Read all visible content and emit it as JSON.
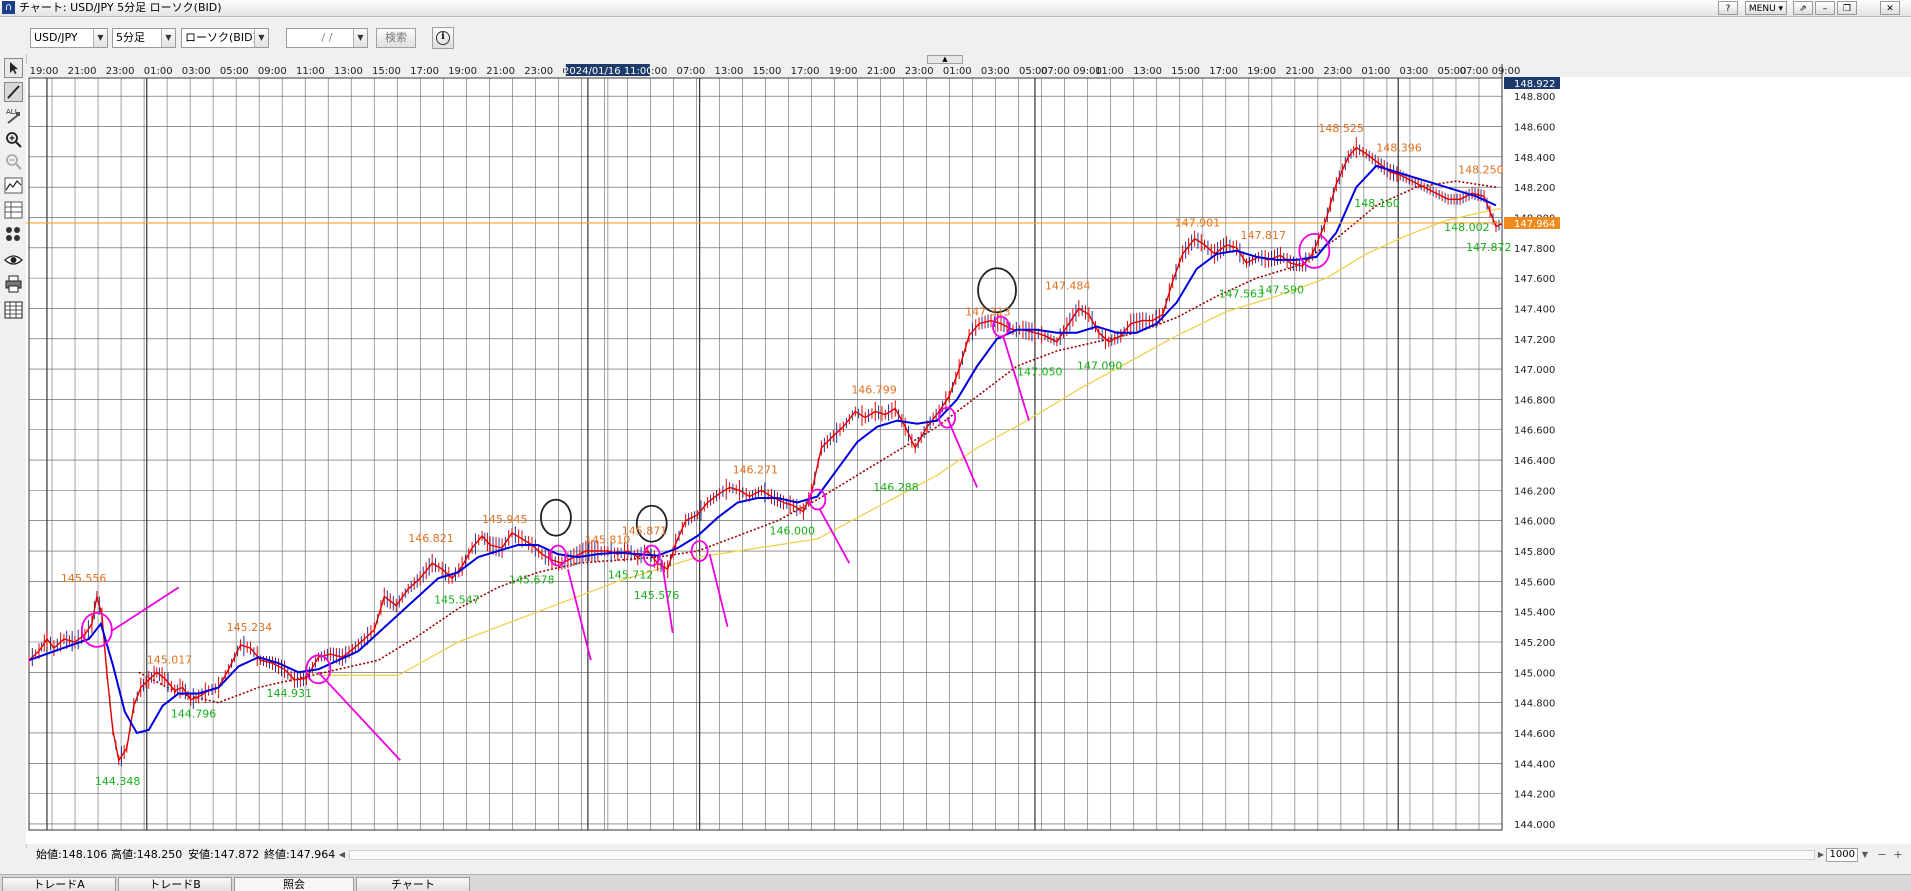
{
  "window": {
    "title": "チャート: USD/JPY 5分足 ローソク(BID)",
    "buttons": [
      "?",
      "MENU ▾",
      "⇗",
      "–",
      "❐",
      "✕"
    ]
  },
  "toolbar": {
    "symbol": "USD/JPY",
    "timeframe": "5分足",
    "price_type": "ローソク(BID)",
    "date_placeholder": "/ /",
    "search_label": "検索"
  },
  "left_tools": [
    "pointer-tool",
    "line-tool",
    "all-delete-tool",
    "zoom-in-tool",
    "zoom-out-tool",
    "indicator-tool",
    "table-tool",
    "pattern-tool",
    "visibility-tool",
    "print-tool",
    "grid-tool"
  ],
  "chart_data": {
    "type": "candlestick-line",
    "symbol": "USD/JPY",
    "y_ticks": [
      "148.800",
      "148.600",
      "148.400",
      "148.200",
      "148.000",
      "147.800",
      "147.600",
      "147.400",
      "147.200",
      "147.000",
      "146.800",
      "146.600",
      "146.400",
      "146.200",
      "146.000",
      "145.800",
      "145.600",
      "145.400",
      "145.200",
      "145.000",
      "144.800",
      "144.600",
      "144.400",
      "144.200",
      "144.000"
    ],
    "ylim": [
      143.96,
      148.92
    ],
    "x_ticks": [
      "19:00",
      "21:00",
      "23:00",
      "01:00",
      "03:00",
      "05:00",
      "09:00",
      "11:00",
      "13:00",
      "15:00",
      "17:00",
      "19:00",
      "21:00",
      "23:00",
      "01:00",
      "03:00",
      "05:00",
      "07:00",
      "13:00",
      "15:00",
      "17:00",
      "19:00",
      "21:00",
      "23:00",
      "01:00",
      "03:00",
      "05:00",
      "07:00 09:00",
      "11:00",
      "13:00",
      "15:00",
      "17:00",
      "19:00",
      "21:00",
      "23:00",
      "01:00",
      "03:00",
      "05:00",
      "07:00 09:00"
    ],
    "cursor_time": "2024/01/16 11:00",
    "cursor_price": "148.922",
    "current_price": "147.964",
    "current_price_level": 147.964,
    "price_path": [
      [
        0,
        145.08
      ],
      [
        10,
        145.14
      ],
      [
        18,
        145.22
      ],
      [
        25,
        145.16
      ],
      [
        35,
        145.22
      ],
      [
        46,
        145.2
      ],
      [
        56,
        145.25
      ],
      [
        63,
        145.32
      ],
      [
        68,
        145.5
      ],
      [
        73,
        145.38
      ],
      [
        78,
        145.0
      ],
      [
        84,
        144.62
      ],
      [
        90,
        144.42
      ],
      [
        98,
        144.5
      ],
      [
        105,
        144.78
      ],
      [
        112,
        144.9
      ],
      [
        120,
        144.95
      ],
      [
        128,
        145.0
      ],
      [
        136,
        144.96
      ],
      [
        146,
        144.88
      ],
      [
        154,
        144.9
      ],
      [
        162,
        144.82
      ],
      [
        170,
        144.84
      ],
      [
        180,
        144.88
      ],
      [
        190,
        144.9
      ],
      [
        200,
        145.02
      ],
      [
        212,
        145.18
      ],
      [
        222,
        145.16
      ],
      [
        232,
        145.08
      ],
      [
        244,
        145.06
      ],
      [
        256,
        145.02
      ],
      [
        266,
        144.95
      ],
      [
        278,
        144.96
      ],
      [
        290,
        145.1
      ],
      [
        302,
        145.12
      ],
      [
        314,
        145.1
      ],
      [
        324,
        145.15
      ],
      [
        336,
        145.22
      ],
      [
        346,
        145.28
      ],
      [
        356,
        145.5
      ],
      [
        368,
        145.44
      ],
      [
        380,
        145.55
      ],
      [
        392,
        145.62
      ],
      [
        404,
        145.72
      ],
      [
        414,
        145.68
      ],
      [
        424,
        145.62
      ],
      [
        434,
        145.7
      ],
      [
        444,
        145.82
      ],
      [
        454,
        145.9
      ],
      [
        462,
        145.84
      ],
      [
        474,
        145.82
      ],
      [
        484,
        145.92
      ],
      [
        494,
        145.88
      ],
      [
        504,
        145.84
      ],
      [
        514,
        145.78
      ],
      [
        524,
        145.74
      ],
      [
        534,
        145.72
      ],
      [
        546,
        145.76
      ],
      [
        558,
        145.8
      ],
      [
        570,
        145.8
      ],
      [
        580,
        145.8
      ],
      [
        590,
        145.78
      ],
      [
        600,
        145.8
      ],
      [
        610,
        145.76
      ],
      [
        620,
        145.8
      ],
      [
        630,
        145.72
      ],
      [
        640,
        145.68
      ],
      [
        648,
        145.85
      ],
      [
        658,
        146.0
      ],
      [
        670,
        146.04
      ],
      [
        680,
        146.12
      ],
      [
        692,
        146.18
      ],
      [
        702,
        146.22
      ],
      [
        712,
        146.2
      ],
      [
        722,
        146.16
      ],
      [
        734,
        146.2
      ],
      [
        744,
        146.16
      ],
      [
        756,
        146.12
      ],
      [
        766,
        146.1
      ],
      [
        776,
        146.06
      ],
      [
        784,
        146.18
      ],
      [
        794,
        146.48
      ],
      [
        806,
        146.56
      ],
      [
        816,
        146.62
      ],
      [
        828,
        146.72
      ],
      [
        838,
        146.68
      ],
      [
        848,
        146.72
      ],
      [
        858,
        146.7
      ],
      [
        868,
        146.74
      ],
      [
        878,
        146.62
      ],
      [
        888,
        146.48
      ],
      [
        900,
        146.62
      ],
      [
        912,
        146.72
      ],
      [
        922,
        146.82
      ],
      [
        932,
        147.0
      ],
      [
        942,
        147.22
      ],
      [
        952,
        147.3
      ],
      [
        964,
        147.32
      ],
      [
        974,
        147.3
      ],
      [
        986,
        147.26
      ],
      [
        996,
        147.26
      ],
      [
        1008,
        147.24
      ],
      [
        1018,
        147.22
      ],
      [
        1030,
        147.18
      ],
      [
        1040,
        147.28
      ],
      [
        1052,
        147.4
      ],
      [
        1062,
        147.36
      ],
      [
        1072,
        147.24
      ],
      [
        1082,
        147.18
      ],
      [
        1094,
        147.22
      ],
      [
        1104,
        147.3
      ],
      [
        1116,
        147.32
      ],
      [
        1126,
        147.32
      ],
      [
        1136,
        147.36
      ],
      [
        1146,
        147.58
      ],
      [
        1156,
        147.76
      ],
      [
        1168,
        147.86
      ],
      [
        1178,
        147.82
      ],
      [
        1188,
        147.76
      ],
      [
        1200,
        147.82
      ],
      [
        1210,
        147.8
      ],
      [
        1220,
        147.7
      ],
      [
        1232,
        147.74
      ],
      [
        1242,
        147.72
      ],
      [
        1254,
        147.75
      ],
      [
        1264,
        147.7
      ],
      [
        1276,
        147.68
      ],
      [
        1286,
        147.76
      ],
      [
        1298,
        147.95
      ],
      [
        1310,
        148.22
      ],
      [
        1322,
        148.4
      ],
      [
        1330,
        148.46
      ],
      [
        1340,
        148.42
      ],
      [
        1352,
        148.36
      ],
      [
        1364,
        148.3
      ],
      [
        1374,
        148.28
      ],
      [
        1386,
        148.24
      ],
      [
        1398,
        148.2
      ],
      [
        1410,
        148.16
      ],
      [
        1422,
        148.12
      ],
      [
        1434,
        148.12
      ],
      [
        1446,
        148.16
      ],
      [
        1458,
        148.14
      ],
      [
        1470,
        147.94
      ],
      [
        1476,
        147.96
      ]
    ],
    "ma_short": [
      [
        0,
        145.08
      ],
      [
        30,
        145.15
      ],
      [
        60,
        145.22
      ],
      [
        72,
        145.32
      ],
      [
        84,
        145.05
      ],
      [
        96,
        144.74
      ],
      [
        108,
        144.6
      ],
      [
        120,
        144.62
      ],
      [
        134,
        144.78
      ],
      [
        150,
        144.86
      ],
      [
        170,
        144.86
      ],
      [
        190,
        144.9
      ],
      [
        210,
        145.04
      ],
      [
        230,
        145.1
      ],
      [
        250,
        145.06
      ],
      [
        270,
        145.0
      ],
      [
        290,
        145.02
      ],
      [
        310,
        145.08
      ],
      [
        330,
        145.14
      ],
      [
        350,
        145.26
      ],
      [
        370,
        145.38
      ],
      [
        390,
        145.5
      ],
      [
        410,
        145.62
      ],
      [
        430,
        145.66
      ],
      [
        450,
        145.76
      ],
      [
        470,
        145.8
      ],
      [
        490,
        145.84
      ],
      [
        510,
        145.84
      ],
      [
        530,
        145.78
      ],
      [
        550,
        145.76
      ],
      [
        570,
        145.78
      ],
      [
        590,
        145.79
      ],
      [
        610,
        145.78
      ],
      [
        630,
        145.77
      ],
      [
        650,
        145.82
      ],
      [
        670,
        145.9
      ],
      [
        690,
        146.02
      ],
      [
        710,
        146.12
      ],
      [
        730,
        146.15
      ],
      [
        750,
        146.15
      ],
      [
        770,
        146.12
      ],
      [
        790,
        146.16
      ],
      [
        810,
        146.34
      ],
      [
        830,
        146.52
      ],
      [
        850,
        146.62
      ],
      [
        870,
        146.66
      ],
      [
        890,
        146.64
      ],
      [
        910,
        146.66
      ],
      [
        930,
        146.8
      ],
      [
        950,
        147.02
      ],
      [
        970,
        147.2
      ],
      [
        990,
        147.26
      ],
      [
        1010,
        147.26
      ],
      [
        1030,
        147.24
      ],
      [
        1050,
        147.24
      ],
      [
        1070,
        147.28
      ],
      [
        1090,
        147.24
      ],
      [
        1110,
        147.24
      ],
      [
        1130,
        147.3
      ],
      [
        1150,
        147.44
      ],
      [
        1170,
        147.66
      ],
      [
        1190,
        147.76
      ],
      [
        1210,
        147.78
      ],
      [
        1230,
        147.74
      ],
      [
        1250,
        147.72
      ],
      [
        1270,
        147.72
      ],
      [
        1290,
        147.74
      ],
      [
        1310,
        147.9
      ],
      [
        1330,
        148.2
      ],
      [
        1350,
        148.34
      ],
      [
        1370,
        148.3
      ],
      [
        1390,
        148.26
      ],
      [
        1410,
        148.22
      ],
      [
        1430,
        148.18
      ],
      [
        1450,
        148.14
      ],
      [
        1470,
        148.08
      ]
    ],
    "ma_mid": [
      [
        110,
        145.0
      ],
      [
        150,
        144.86
      ],
      [
        190,
        144.8
      ],
      [
        230,
        144.9
      ],
      [
        270,
        144.96
      ],
      [
        310,
        145.02
      ],
      [
        350,
        145.08
      ],
      [
        390,
        145.24
      ],
      [
        430,
        145.42
      ],
      [
        470,
        145.56
      ],
      [
        510,
        145.66
      ],
      [
        550,
        145.72
      ],
      [
        590,
        145.74
      ],
      [
        630,
        145.76
      ],
      [
        670,
        145.8
      ],
      [
        710,
        145.9
      ],
      [
        750,
        146.0
      ],
      [
        790,
        146.14
      ],
      [
        830,
        146.3
      ],
      [
        870,
        146.46
      ],
      [
        910,
        146.62
      ],
      [
        950,
        146.82
      ],
      [
        990,
        147.02
      ],
      [
        1030,
        147.12
      ],
      [
        1070,
        147.18
      ],
      [
        1110,
        147.24
      ],
      [
        1150,
        147.34
      ],
      [
        1190,
        147.48
      ],
      [
        1230,
        147.6
      ],
      [
        1270,
        147.68
      ],
      [
        1310,
        147.86
      ],
      [
        1350,
        148.08
      ],
      [
        1390,
        148.2
      ],
      [
        1430,
        148.24
      ],
      [
        1470,
        148.2
      ]
    ],
    "ma_long": [
      [
        290,
        144.98
      ],
      [
        370,
        144.98
      ],
      [
        430,
        145.2
      ],
      [
        510,
        145.4
      ],
      [
        590,
        145.6
      ],
      [
        670,
        145.76
      ],
      [
        750,
        145.84
      ],
      [
        790,
        145.88
      ],
      [
        830,
        146.02
      ],
      [
        870,
        146.16
      ],
      [
        910,
        146.3
      ],
      [
        950,
        146.48
      ],
      [
        1000,
        146.66
      ],
      [
        1050,
        146.86
      ],
      [
        1100,
        147.04
      ],
      [
        1150,
        147.22
      ],
      [
        1200,
        147.38
      ],
      [
        1250,
        147.48
      ],
      [
        1300,
        147.6
      ],
      [
        1340,
        147.76
      ],
      [
        1380,
        147.88
      ],
      [
        1420,
        147.98
      ],
      [
        1460,
        148.04
      ],
      [
        1476,
        148.06
      ]
    ],
    "annotations_orange": [
      {
        "text": "145.556",
        "t": 32,
        "p": 145.556
      },
      {
        "text": "145.017",
        "t": 118,
        "p": 145.017
      },
      {
        "text": "145.234",
        "t": 198,
        "p": 145.234
      },
      {
        "text": "146.821",
        "t": 380,
        "p": 145.821
      },
      {
        "text": "145.945",
        "t": 454,
        "p": 145.945
      },
      {
        "text": "145.810",
        "t": 557,
        "p": 145.81
      },
      {
        "text": "145.871",
        "t": 594,
        "p": 145.871
      },
      {
        "text": "146.271",
        "t": 705,
        "p": 146.271
      },
      {
        "text": "146.799",
        "t": 824,
        "p": 146.799
      },
      {
        "text": "147.313",
        "t": 938,
        "p": 147.313
      },
      {
        "text": "147.484",
        "t": 1018,
        "p": 147.484
      },
      {
        "text": "147.901",
        "t": 1148,
        "p": 147.901
      },
      {
        "text": "147.817",
        "t": 1214,
        "p": 147.817
      },
      {
        "text": "148.525",
        "t": 1292,
        "p": 148.525
      },
      {
        "text": "148.396",
        "t": 1350,
        "p": 148.396
      },
      {
        "text": "148.250",
        "t": 1432,
        "p": 148.25
      }
    ],
    "annotations_green": [
      {
        "text": "144.348",
        "t": 66,
        "p": 144.348
      },
      {
        "text": "144.796",
        "t": 142,
        "p": 144.796
      },
      {
        "text": "144.931",
        "t": 238,
        "p": 144.931
      },
      {
        "text": "145.547",
        "t": 406,
        "p": 145.547
      },
      {
        "text": "145.678",
        "t": 481,
        "p": 145.678
      },
      {
        "text": "145.712",
        "t": 580,
        "p": 145.712
      },
      {
        "text": "145.576",
        "t": 606,
        "p": 145.576
      },
      {
        "text": "146.000",
        "t": 742,
        "p": 146.0
      },
      {
        "text": "146.288",
        "t": 846,
        "p": 146.288
      },
      {
        "text": "147.050",
        "t": 990,
        "p": 147.05
      },
      {
        "text": "147.090",
        "t": 1050,
        "p": 147.09
      },
      {
        "text": "147.563",
        "t": 1192,
        "p": 147.563
      },
      {
        "text": "147.590",
        "t": 1232,
        "p": 147.59
      },
      {
        "text": "148.160",
        "t": 1328,
        "p": 148.16
      },
      {
        "text": "148.002",
        "t": 1418,
        "p": 148.002
      },
      {
        "text": "147.872",
        "t": 1440,
        "p": 147.872
      }
    ],
    "circles_magenta": [
      [
        68,
        145.28
      ],
      [
        290,
        145.02
      ],
      [
        530,
        145.77
      ],
      [
        624,
        145.77
      ],
      [
        672,
        145.8
      ],
      [
        790,
        146.14
      ],
      [
        920,
        146.68
      ],
      [
        974,
        147.28
      ],
      [
        1288,
        147.78
      ]
    ],
    "circles_dark": [
      [
        528,
        146.02
      ],
      [
        624,
        145.98
      ],
      [
        970,
        147.52
      ]
    ],
    "pink_lines": [
      [
        [
          82,
          145.27
        ],
        [
          150,
          145.56
        ]
      ],
      [
        [
          290,
          145.0
        ],
        [
          372,
          144.42
        ]
      ],
      [
        [
          540,
          145.68
        ],
        [
          563,
          145.08
        ]
      ],
      [
        [
          634,
          145.74
        ],
        [
          645,
          145.26
        ]
      ],
      [
        [
          682,
          145.78
        ],
        [
          700,
          145.3
        ]
      ],
      [
        [
          792,
          146.08
        ],
        [
          822,
          145.72
        ]
      ],
      [
        [
          920,
          146.68
        ],
        [
          950,
          146.22
        ]
      ],
      [
        [
          976,
          147.22
        ],
        [
          1002,
          146.66
        ]
      ],
      [
        [
          1290,
          147.72
        ],
        [
          1290,
          147.72
        ]
      ]
    ]
  },
  "status": {
    "open": "始値:148.106",
    "high": "高値:148.250",
    "low": "安値:147.872",
    "close": "終値:147.964",
    "count": "1000"
  },
  "tabs": [
    "トレードA",
    "トレードB",
    "照会",
    "チャート"
  ],
  "colors": {
    "price": "#e00000",
    "ma_short": "#0000dd",
    "ma_mid": "#a00000",
    "ma_long": "#f0d050",
    "current_line": "#f5a030",
    "label_orange": "#e07020",
    "label_green": "#18b018",
    "marker": "#f000e0"
  }
}
